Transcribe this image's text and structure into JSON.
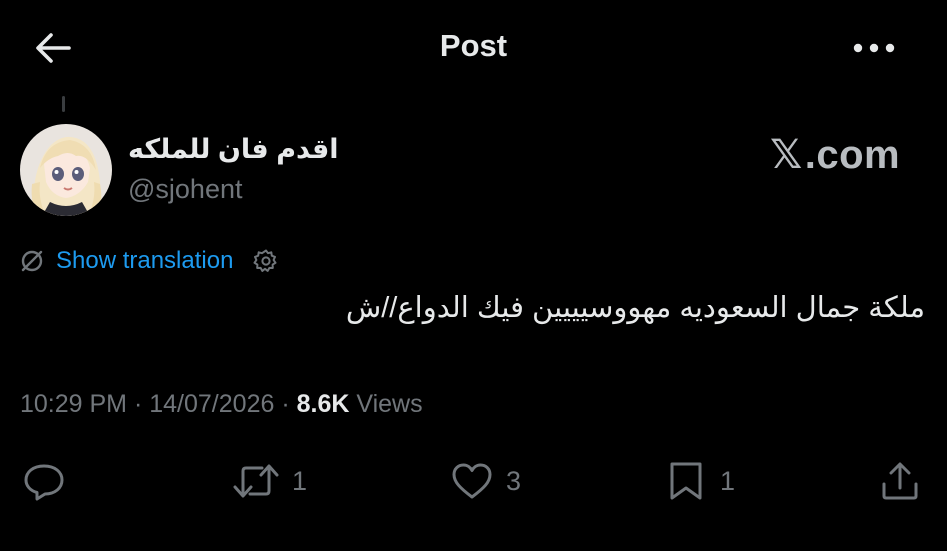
{
  "header": {
    "title": "Post",
    "back_icon": "arrow-left-icon",
    "more_icon": "more-horizontal-icon"
  },
  "author": {
    "display_name": "اقدم فان للملكه",
    "handle": "@sjohent",
    "avatar_icon": "anime-avatar"
  },
  "watermark": {
    "x_glyph": "𝕏",
    "suffix": ".com"
  },
  "translation": {
    "link_label": "Show translation",
    "icon": "translate-off-icon",
    "settings_icon": "gear-icon"
  },
  "tweet": {
    "text": "ملكة جمال السعوديه مهووسيييين فيك الدواع//ش"
  },
  "meta": {
    "time": "10:29 PM",
    "date": "14/07/2026",
    "views_count": "8.6K",
    "views_label": "Views",
    "separator": "·"
  },
  "actions": {
    "reply": {
      "icon": "reply-icon",
      "count": ""
    },
    "repost": {
      "icon": "repost-icon",
      "count": "1"
    },
    "like": {
      "icon": "heart-icon",
      "count": "3"
    },
    "bookmark": {
      "icon": "bookmark-icon",
      "count": "1"
    },
    "share": {
      "icon": "share-icon",
      "count": ""
    }
  },
  "colors": {
    "background": "#000000",
    "text": "#e7e9ea",
    "muted": "#71767b",
    "link": "#1d9bf0"
  }
}
